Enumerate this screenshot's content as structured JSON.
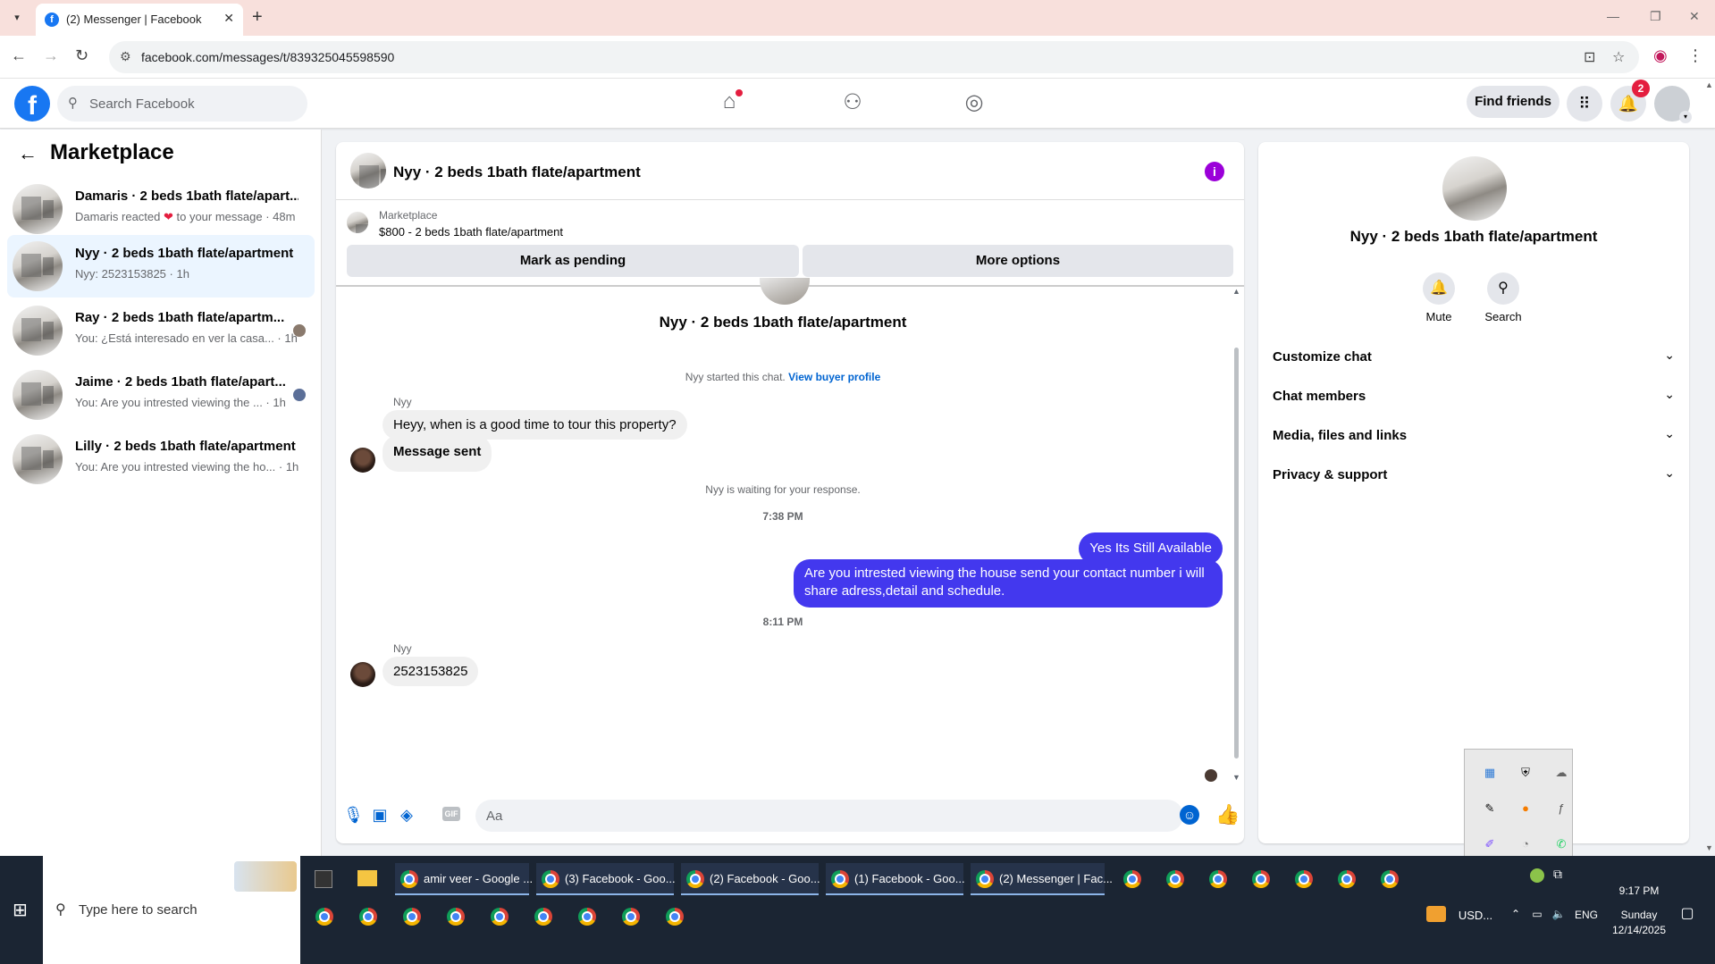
{
  "browser": {
    "tab_title": "(2) Messenger | Facebook",
    "url": "facebook.com/messages/t/839325045598590"
  },
  "fb": {
    "search_placeholder": "Search Facebook",
    "find_friends": "Find friends",
    "notification_count": "2"
  },
  "sidebar": {
    "title": "Marketplace",
    "conversations": [
      {
        "name": "Damaris · 2 beds 1bath flate/apart...",
        "snippet_a": "Damaris reacted ",
        "snippet_b": " to your message · 48m"
      },
      {
        "name": "Nyy · 2 beds 1bath flate/apartment",
        "snippet": "Nyy: 2523153825 · 1h"
      },
      {
        "name": "Ray · 2 beds 1bath flate/apartm...",
        "snippet": "You: ¿Está interesado en ver la casa... · 1h"
      },
      {
        "name": "Jaime · 2 beds 1bath flate/apart...",
        "snippet": "You: Are you intrested viewing the ... · 1h"
      },
      {
        "name": "Lilly · 2 beds 1bath flate/apartment",
        "snippet": "You: Are you intrested viewing the ho... · 1h"
      }
    ]
  },
  "chat": {
    "title": "Nyy · 2 beds 1bath flate/apartment",
    "marketplace_label": "Marketplace",
    "listing": "$800 - 2 beds 1bath flate/apartment",
    "mark_pending": "Mark as pending",
    "more_options": "More options",
    "center_name": "Nyy · 2 beds 1bath flate/apartment",
    "started_text": "Nyy started this chat. ",
    "view_buyer_profile": "View buyer profile",
    "sender_name": "Nyy",
    "msg1": "Heyy, when is a good time to tour this property?",
    "msg2": "Message sent",
    "waiting": "Nyy is waiting for your response.",
    "time1": "7:38 PM",
    "out1": "Yes Its Still Available",
    "out2": "Are you intrested viewing the house send your contact number i will share adress,detail and schedule.",
    "time2": "8:11 PM",
    "sender_name2": "Nyy",
    "msg3": "2523153825",
    "composer_placeholder": "Aa"
  },
  "details": {
    "title": "Nyy · 2 beds 1bath flate/apartment",
    "mute": "Mute",
    "search": "Search",
    "rows": [
      "Customize chat",
      "Chat members",
      "Media, files and links",
      "Privacy & support"
    ]
  },
  "taskbar": {
    "search_placeholder": "Type here to search",
    "apps": [
      "amir veer - Google ...",
      "(3) Facebook - Goo...",
      "(2) Facebook - Goo...",
      "(1) Facebook - Goo...",
      "(2) Messenger | Fac..."
    ],
    "currency": "USD...",
    "lang": "ENG",
    "time": "9:17 PM",
    "day": "Sunday",
    "date": "12/14/2025"
  }
}
